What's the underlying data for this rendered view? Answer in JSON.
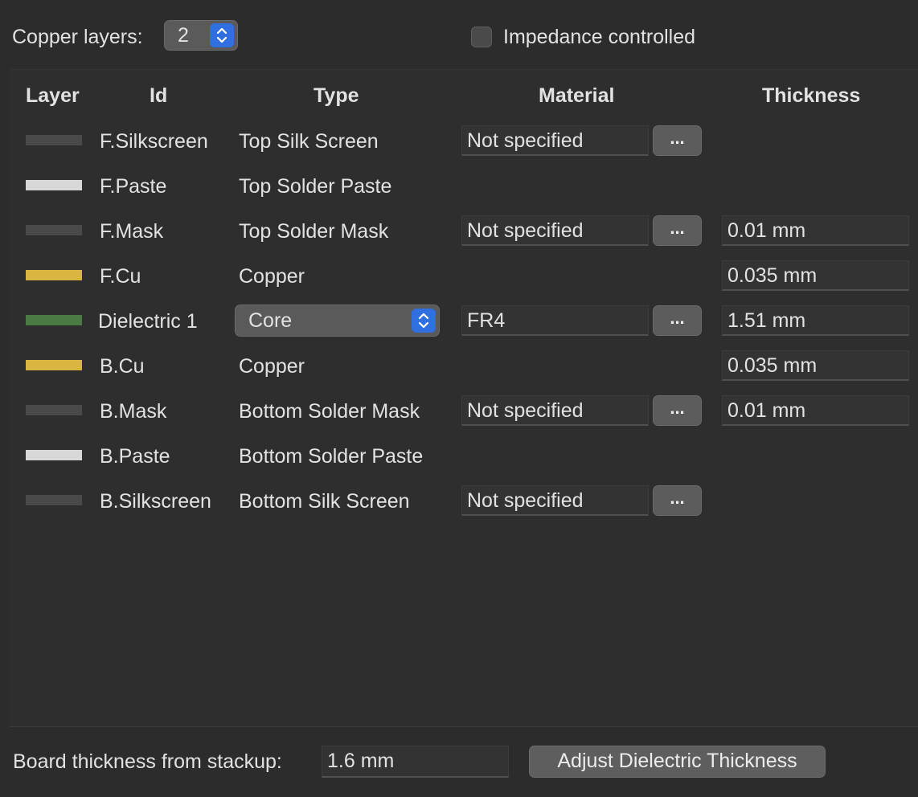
{
  "copper_layers": {
    "label": "Copper layers:",
    "value": "2"
  },
  "impedance": {
    "label": "Impedance controlled",
    "checked": false
  },
  "columns": {
    "layer": "Layer",
    "id": "Id",
    "type": "Type",
    "material": "Material",
    "thickness": "Thickness"
  },
  "rows": [
    {
      "id": "F.Silkscreen",
      "type": "Top Silk Screen",
      "color": "#4a4a4a",
      "material": "Not specified",
      "thickness": ""
    },
    {
      "id": "F.Paste",
      "type": "Top Solder Paste",
      "color": "#d8d8d8",
      "material": "",
      "thickness": ""
    },
    {
      "id": "F.Mask",
      "type": "Top Solder Mask",
      "color": "#4a4a4a",
      "material": "Not specified",
      "thickness": "0.01 mm"
    },
    {
      "id": "F.Cu",
      "type": "Copper",
      "color": "#d9b641",
      "material": "",
      "thickness": "0.035 mm"
    },
    {
      "id": "Dielectric 1",
      "type": "Core",
      "color": "#4b7a45",
      "material": "FR4",
      "thickness": "1.51 mm"
    },
    {
      "id": "B.Cu",
      "type": "Copper",
      "color": "#d9b641",
      "material": "",
      "thickness": "0.035 mm"
    },
    {
      "id": "B.Mask",
      "type": "Bottom Solder Mask",
      "color": "#4a4a4a",
      "material": "Not specified",
      "thickness": "0.01 mm"
    },
    {
      "id": "B.Paste",
      "type": "Bottom Solder Paste",
      "color": "#d8d8d8",
      "material": "",
      "thickness": ""
    },
    {
      "id": "B.Silkscreen",
      "type": "Bottom Silk Screen",
      "color": "#4a4a4a",
      "material": "Not specified",
      "thickness": ""
    }
  ],
  "material_button_label": "...",
  "board_thickness": {
    "label": "Board thickness from stackup:",
    "value": "1.6 mm"
  },
  "adjust_button": "Adjust Dielectric Thickness"
}
